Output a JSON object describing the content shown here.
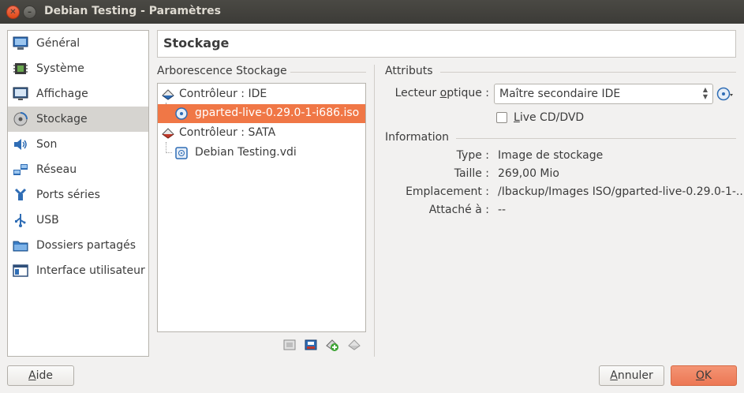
{
  "window": {
    "title": "Debian Testing - Paramètres"
  },
  "sidebar": {
    "items": [
      {
        "label": "Général"
      },
      {
        "label": "Système"
      },
      {
        "label": "Affichage"
      },
      {
        "label": "Stockage"
      },
      {
        "label": "Son"
      },
      {
        "label": "Réseau"
      },
      {
        "label": "Ports séries"
      },
      {
        "label": "USB"
      },
      {
        "label": "Dossiers partagés"
      },
      {
        "label": "Interface utilisateur"
      }
    ],
    "selected": "Stockage"
  },
  "header": {
    "title": "Stockage"
  },
  "storage_tree": {
    "title": "Arborescence Stockage",
    "controllers": [
      {
        "label": "Contrôleur : IDE",
        "children": [
          "gparted-live-0.29.0-1-i686.iso"
        ]
      },
      {
        "label": "Contrôleur : SATA",
        "children": [
          "Debian Testing.vdi"
        ]
      }
    ],
    "selected_item": "gparted-live-0.29.0-1-i686.iso"
  },
  "attributes": {
    "title": "Attributs",
    "optical_drive_label_pre": "Lecteur ",
    "optical_drive_label_u": "o",
    "optical_drive_label_post": "ptique :",
    "optical_drive_value": "Maître secondaire IDE",
    "live_cd_label_pre": "",
    "live_cd_label_u": "L",
    "live_cd_label_post": "ive CD/DVD",
    "live_cd_checked": false
  },
  "information": {
    "title": "Information",
    "rows": [
      {
        "label": "Type :",
        "value": "Image de stockage"
      },
      {
        "label": "Taille :",
        "value": "269,00 Mio"
      },
      {
        "label": "Emplacement :",
        "value": "/Ibackup/Images ISO/gparted-live-0.29.0-1-..."
      },
      {
        "label": "Attaché à :",
        "value": "--"
      }
    ]
  },
  "footer": {
    "help_u": "A",
    "help_rest": "ide",
    "cancel_u": "A",
    "cancel_rest": "nnuler",
    "ok_u": "O",
    "ok_rest": "K"
  },
  "colors": {
    "selection": "#f07746",
    "ok_button": "#ec7754",
    "titlebar": "#3c3b37"
  }
}
